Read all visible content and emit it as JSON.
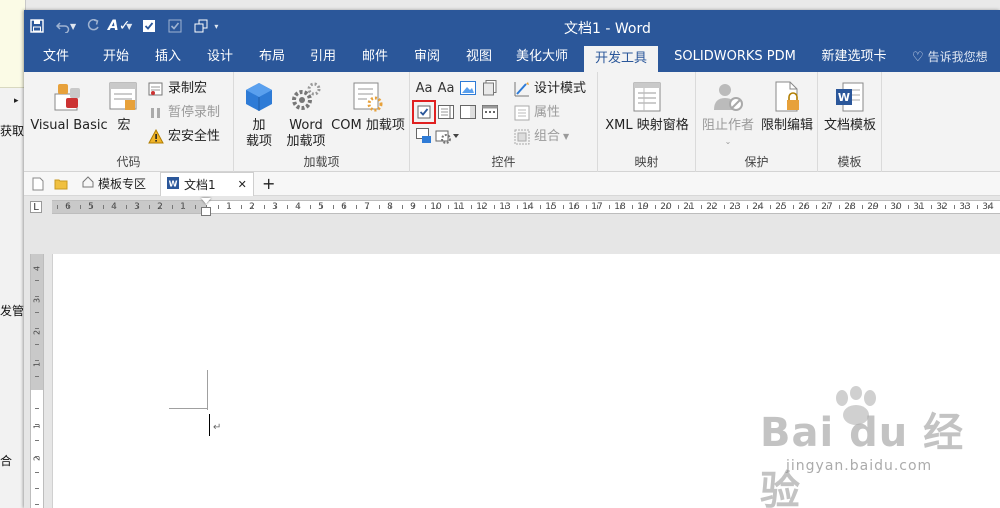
{
  "background_window": {
    "texts": [
      "▸",
      "获取",
      "发管",
      "合"
    ]
  },
  "titlebar": {
    "title": "文档1 - Word"
  },
  "tabs": [
    {
      "label": "文件"
    },
    {
      "label": "开始"
    },
    {
      "label": "插入"
    },
    {
      "label": "设计"
    },
    {
      "label": "布局"
    },
    {
      "label": "引用"
    },
    {
      "label": "邮件"
    },
    {
      "label": "审阅"
    },
    {
      "label": "视图"
    },
    {
      "label": "美化大师"
    },
    {
      "label": "开发工具",
      "active": true
    },
    {
      "label": "SOLIDWORKS PDM"
    },
    {
      "label": "新建选项卡"
    }
  ],
  "tellme": {
    "placeholder": "告诉我您想"
  },
  "ribbon": {
    "code": {
      "label": "代码",
      "visual_basic": "Visual Basic",
      "macros": "宏",
      "record_macro": "录制宏",
      "pause_recording": "暂停录制",
      "macro_security": "宏安全性"
    },
    "addins": {
      "label": "加载项",
      "addins_line1": "加",
      "addins_line2": "载项",
      "word_addins_line1": "Word",
      "word_addins_line2": "加载项",
      "com_addins": "COM 加载项"
    },
    "controls": {
      "label": "控件",
      "design_mode": "设计模式",
      "properties": "属性",
      "group": "组合"
    },
    "mapping": {
      "label": "映射",
      "xml_mapping": "XML 映射窗格"
    },
    "protect": {
      "label": "保护",
      "block_authors": "阻止作者",
      "restrict_editing": "限制编辑"
    },
    "templates": {
      "label": "模板",
      "document_template": "文档模板"
    }
  },
  "doc_tabs": {
    "template_zone": "模板专区",
    "current_doc": "文档1",
    "close": "✕",
    "add": "+"
  },
  "ruler": {
    "tab_selector": "L",
    "left_numbers": [
      "6",
      "5",
      "4",
      "3",
      "2",
      "1"
    ],
    "right_numbers": [
      "1",
      "2",
      "3",
      "4",
      "5",
      "6",
      "7",
      "8",
      "9",
      "10",
      "11",
      "12",
      "13",
      "14",
      "15",
      "16",
      "17",
      "18",
      "19",
      "20",
      "21",
      "22",
      "23",
      "24",
      "25",
      "26",
      "27",
      "28",
      "29",
      "30",
      "31",
      "32",
      "33",
      "34"
    ],
    "vertical_numbers": [
      "4",
      "3",
      "2",
      "1",
      "1",
      "2"
    ]
  },
  "watermark": {
    "main": "Bai du 经验",
    "sub": "jingyan.baidu.com"
  },
  "colors": {
    "word_blue": "#2b579a",
    "ribbon_bg": "#f3f3f3",
    "highlight_red": "#e02020"
  }
}
